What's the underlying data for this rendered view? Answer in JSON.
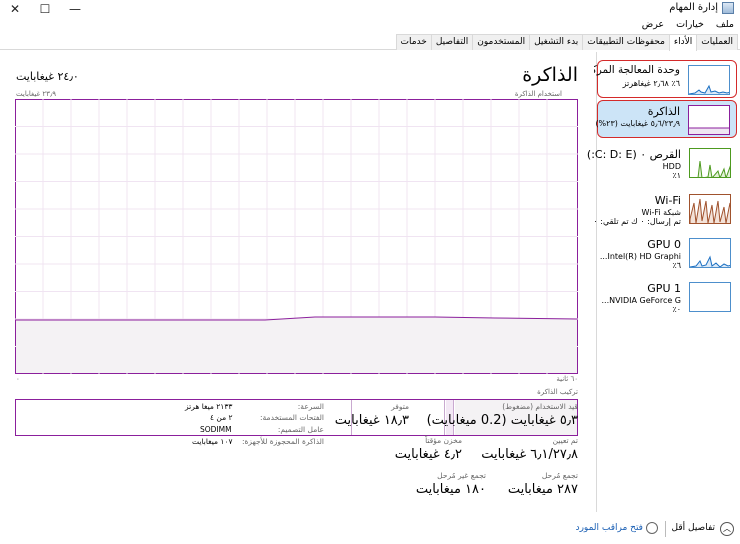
{
  "window": {
    "title": "إدارة المهام"
  },
  "menu": [
    "ملف",
    "خيارات",
    "عرض"
  ],
  "tabs": [
    {
      "label": "العمليات",
      "active": false
    },
    {
      "label": "الأداء",
      "active": true
    },
    {
      "label": "محفوظات التطبيقات",
      "active": false
    },
    {
      "label": "بدء التشغيل",
      "active": false
    },
    {
      "label": "المستخدمون",
      "active": false
    },
    {
      "label": "التفاصيل",
      "active": false
    },
    {
      "label": "خدمات",
      "active": false
    }
  ],
  "sidebar": [
    {
      "name": "وحدة المعالجة المركزية",
      "sub1": "٦٪ ٢٫٦٨ غيغاهرتز",
      "sub2": "",
      "color": "#1a6fc2"
    },
    {
      "name": "الذاكرة",
      "sub1": "٥٫٦/٢٣٫٩ غيغابايت (٢٣%)",
      "sub2": "",
      "color": "#8b1f9c"
    },
    {
      "name": "القرص ٠ (C: D: E:)",
      "sub1": "HDD",
      "sub2": "١٪",
      "color": "#4d9a1f"
    },
    {
      "name": "Wi-Fi",
      "sub1": "شبكة Wi-Fi",
      "sub2": "تم إرسال: ٠ ك تم تلقي: ٠ ك",
      "color": "#a0522d"
    },
    {
      "name": "GPU 0",
      "sub1": "Intel(R) HD Graphi...",
      "sub2": "٦٪",
      "color": "#1a6fc2"
    },
    {
      "name": "GPU 1",
      "sub1": "NVIDIA GeForce G...",
      "sub2": "٠٪",
      "color": "#1a6fc2"
    }
  ],
  "main": {
    "title": "الذاكرة",
    "total": "٢٤٫٠ غيغابايت",
    "usage_label": "استخدام الذاكرة",
    "usage_max": "٢٣٫٩ غيغابايت",
    "time_left": "٦٠ ثانية",
    "time_right": "٠",
    "composition_label": "تركيب الذاكرة",
    "accent": "#8b1f9c",
    "fill": "#f4f2f4"
  },
  "stats": {
    "in_use_label": "قيد الاستخدام (مضغوط)",
    "in_use": "٥٫٣ غيغابايت (0.2 ميغابايت)",
    "available_label": "متوفر",
    "available": "١٨٫٣ غيغابايت",
    "committed_label": "تم تعيين",
    "committed": "٦٫١/٢٧٫٨ غيغابايت",
    "cached_label": "مخزن مؤقتاً",
    "cached": "٤٫٢ غيغابايت",
    "paged_label": "تجمع مُرحل",
    "paged": "٢٨٧ ميغابايت",
    "nonpaged_label": "تجمع غير مُرحل",
    "nonpaged": "١٨٠ ميغابايت"
  },
  "details": [
    {
      "label": "السرعة:",
      "value": "٢١٣٣ ميغا هرتز"
    },
    {
      "label": "الفتحات المستخدمة:",
      "value": "٢ من ٤"
    },
    {
      "label": "عامل التصميم:",
      "value": "SODIMM"
    },
    {
      "label": "الذاكرة المحجوزة للأجهزة:",
      "value": "١٠٧ ميغابايت"
    }
  ],
  "footer": {
    "fewer_details": "تفاصيل أقل",
    "open_monitor": "فتح مراقب المورد"
  }
}
